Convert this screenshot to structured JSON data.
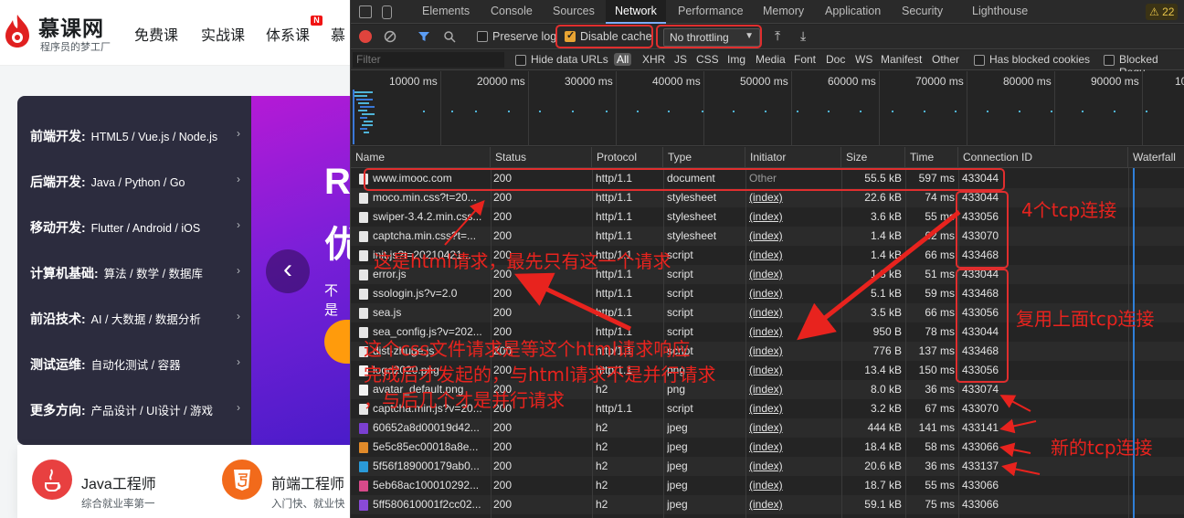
{
  "site": {
    "logo_text": "慕课网",
    "logo_sub": "程序员的梦工厂",
    "nav": [
      "免费课",
      "实战课",
      "体系课",
      "慕"
    ],
    "new_badge": "N",
    "categories": [
      {
        "title": "前端开发:",
        "items": "HTML5 / Vue.js / Node.js"
      },
      {
        "title": "后端开发:",
        "items": "Java / Python / Go"
      },
      {
        "title": "移动开发:",
        "items": "Flutter / Android / iOS"
      },
      {
        "title": "计算机基础:",
        "items": "算法 / 数学 / 数据库"
      },
      {
        "title": "前沿技术:",
        "items": "AI / 大数据 / 数据分析"
      },
      {
        "title": "测试运维:",
        "items": "自动化测试 / 容器"
      },
      {
        "title": "更多方向:",
        "items": "产品设计 / UI设计 / 游戏"
      }
    ],
    "arrow": "›",
    "banner_big_1": "R",
    "banner_big_2": "优",
    "banner_small": "不是",
    "banner_prev": "‹",
    "careers": [
      {
        "title": "Java工程师",
        "sub": "综合就业率第一",
        "color": "#e84040"
      },
      {
        "title": "前端工程师",
        "sub": "入门快、就业快",
        "color": "#f26a1b"
      }
    ]
  },
  "devtools": {
    "tabs": [
      "Elements",
      "Console",
      "Sources",
      "Network",
      "Performance",
      "Memory",
      "Application",
      "Security",
      "Lighthouse"
    ],
    "active_tab": "Network",
    "warn_count": "⚠ 22",
    "toolbar": {
      "preserve_log": "Preserve log",
      "disable_cache": "Disable cache",
      "throttling": "No throttling",
      "throttle_arrow": "▼",
      "upload": "⤒",
      "download": "⤓"
    },
    "filter": {
      "placeholder": "Filter",
      "hide_data_urls": "Hide data URLs",
      "types": [
        "All",
        "XHR",
        "JS",
        "CSS",
        "Img",
        "Media",
        "Font",
        "Doc",
        "WS",
        "Manifest",
        "Other"
      ],
      "has_blocked_cookies": "Has blocked cookies",
      "blocked_requests": "Blocked Requ"
    },
    "overview_ticks": [
      "10000 ms",
      "20000 ms",
      "30000 ms",
      "40000 ms",
      "50000 ms",
      "60000 ms",
      "70000 ms",
      "80000 ms",
      "90000 ms",
      "10"
    ],
    "columns": [
      "Name",
      "Status",
      "Protocol",
      "Type",
      "Initiator",
      "Size",
      "Time",
      "Connection ID",
      "Waterfall"
    ],
    "rows": [
      {
        "name": "www.imooc.com",
        "status": "200",
        "protocol": "http/1.1",
        "type": "document",
        "initiator": "Other",
        "size": "55.5 kB",
        "time": "597 ms",
        "conn": "433044",
        "icon": "#e6e6e6"
      },
      {
        "name": "moco.min.css?t=20...",
        "status": "200",
        "protocol": "http/1.1",
        "type": "stylesheet",
        "initiator": "(index)",
        "size": "22.6 kB",
        "time": "74 ms",
        "conn": "433044",
        "icon": "#e6e6e6"
      },
      {
        "name": "swiper-3.4.2.min.css...",
        "status": "200",
        "protocol": "http/1.1",
        "type": "stylesheet",
        "initiator": "(index)",
        "size": "3.6 kB",
        "time": "55 ms",
        "conn": "433056",
        "icon": "#e6e6e6"
      },
      {
        "name": "captcha.min.css?t=...",
        "status": "200",
        "protocol": "http/1.1",
        "type": "stylesheet",
        "initiator": "(index)",
        "size": "1.4 kB",
        "time": "62 ms",
        "conn": "433070",
        "icon": "#e6e6e6"
      },
      {
        "name": "init.js?t=20210421...",
        "status": "200",
        "protocol": "http/1.1",
        "type": "script",
        "initiator": "(index)",
        "size": "1.4 kB",
        "time": "66 ms",
        "conn": "433468",
        "icon": "#e6e6e6"
      },
      {
        "name": "error.js",
        "status": "200",
        "protocol": "http/1.1",
        "type": "script",
        "initiator": "(index)",
        "size": "1.3 kB",
        "time": "51 ms",
        "conn": "433044",
        "icon": "#e6e6e6"
      },
      {
        "name": "ssologin.js?v=2.0",
        "status": "200",
        "protocol": "http/1.1",
        "type": "script",
        "initiator": "(index)",
        "size": "5.1 kB",
        "time": "59 ms",
        "conn": "433468",
        "icon": "#e6e6e6"
      },
      {
        "name": "sea.js",
        "status": "200",
        "protocol": "http/1.1",
        "type": "script",
        "initiator": "(index)",
        "size": "3.5 kB",
        "time": "66 ms",
        "conn": "433056",
        "icon": "#e6e6e6"
      },
      {
        "name": "sea_config.js?v=202...",
        "status": "200",
        "protocol": "http/1.1",
        "type": "script",
        "initiator": "(index)",
        "size": "950 B",
        "time": "78 ms",
        "conn": "433044",
        "icon": "#e6e6e6"
      },
      {
        "name": "dist-zhuge.js",
        "status": "200",
        "protocol": "http/1.1",
        "type": "script",
        "initiator": "(index)",
        "size": "776 B",
        "time": "137 ms",
        "conn": "433468",
        "icon": "#e6e6e6"
      },
      {
        "name": "logo2020.png",
        "status": "200",
        "protocol": "http/1.1",
        "type": "png",
        "initiator": "(index)",
        "size": "13.4 kB",
        "time": "150 ms",
        "conn": "433056",
        "icon": "#f3f3f3"
      },
      {
        "name": "avatar_default.png",
        "status": "200",
        "protocol": "h2",
        "type": "png",
        "initiator": "(index)",
        "size": "8.0 kB",
        "time": "36 ms",
        "conn": "433074",
        "icon": "#f3f3f3"
      },
      {
        "name": "captcha.min.js?v=20...",
        "status": "200",
        "protocol": "http/1.1",
        "type": "script",
        "initiator": "(index)",
        "size": "3.2 kB",
        "time": "67 ms",
        "conn": "433070",
        "icon": "#e6e6e6"
      },
      {
        "name": "60652a8d00019d42...",
        "status": "200",
        "protocol": "h2",
        "type": "jpeg",
        "initiator": "(index)",
        "size": "444 kB",
        "time": "141 ms",
        "conn": "433141",
        "icon": "#7a3fd0"
      },
      {
        "name": "5e5c85ec00018a8e...",
        "status": "200",
        "protocol": "h2",
        "type": "jpeg",
        "initiator": "(index)",
        "size": "18.4 kB",
        "time": "58 ms",
        "conn": "433066",
        "icon": "#e08a2a"
      },
      {
        "name": "5f56f189000179ab0...",
        "status": "200",
        "protocol": "h2",
        "type": "jpeg",
        "initiator": "(index)",
        "size": "20.6 kB",
        "time": "36 ms",
        "conn": "433137",
        "icon": "#2a9ad8"
      },
      {
        "name": "5eb68ac100010292...",
        "status": "200",
        "protocol": "h2",
        "type": "jpeg",
        "initiator": "(index)",
        "size": "18.7 kB",
        "time": "55 ms",
        "conn": "433066",
        "icon": "#d84a8a"
      },
      {
        "name": "5ff580610001f2cc02...",
        "status": "200",
        "protocol": "h2",
        "type": "jpeg",
        "initiator": "(index)",
        "size": "59.1 kB",
        "time": "75 ms",
        "conn": "433066",
        "icon": "#8a4ad8"
      }
    ]
  },
  "annotations": {
    "four_tcp": "4个tcp连接",
    "html_first": "这是html请求，最先只有这一个请求",
    "reuse_tcp": "复用上面tcp连接",
    "css_line1": "这个css文件请求是等这个html请求响应",
    "css_line2": "完成后才发起的，与html请求不是并行请求",
    "css_line3": "，与后几个才是并行请求",
    "new_tcp": "新的tcp连接",
    "color": "#e8231e"
  }
}
